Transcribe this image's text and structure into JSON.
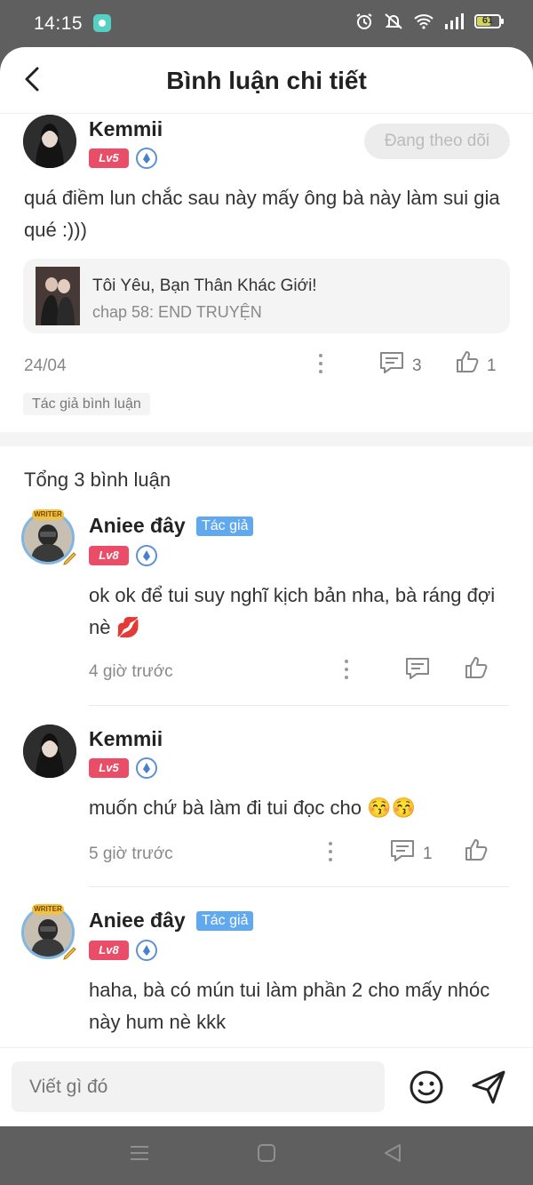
{
  "status_bar": {
    "time": "14:15",
    "battery": "61",
    "battery_level": 0.61
  },
  "header": {
    "title": "Bình luận chi tiết"
  },
  "main_comment": {
    "user": "Kemmii",
    "level": "Lv5",
    "follow_label": "Đang theo dõi",
    "text": "quá điềm lun chắc sau này mấy ông bà này làm sui gia qué :)))",
    "book": {
      "title": "Tôi Yêu, Bạn Thân Khác Giới!",
      "chapter": "chap 58: END TRUYỆN"
    },
    "date": "24/04",
    "reply_count": "3",
    "like_count": "1",
    "author_chip": "Tác giả bình luận"
  },
  "replies_header": "Tổng 3 bình luận",
  "writer_badge": "WRITER",
  "replies": [
    {
      "user": "Aniee đây",
      "author_tag": "Tác giả",
      "level": "Lv8",
      "text": "ok ok để tui suy nghĩ kịch bản nha, bà ráng đợi nè 💋",
      "time": "4 giờ trước"
    },
    {
      "user": "Kemmii",
      "level": "Lv5",
      "text": "muốn chứ bà làm đi tui đọc cho 😚😚",
      "time": "5 giờ trước",
      "reply_count": "1"
    },
    {
      "user": "Aniee đây",
      "author_tag": "Tác giả",
      "level": "Lv8",
      "text": "haha, bà có mún tui làm phần 2 cho mấy nhóc này hum nè kkk"
    }
  ],
  "composer": {
    "placeholder": "Viết gì đó"
  }
}
